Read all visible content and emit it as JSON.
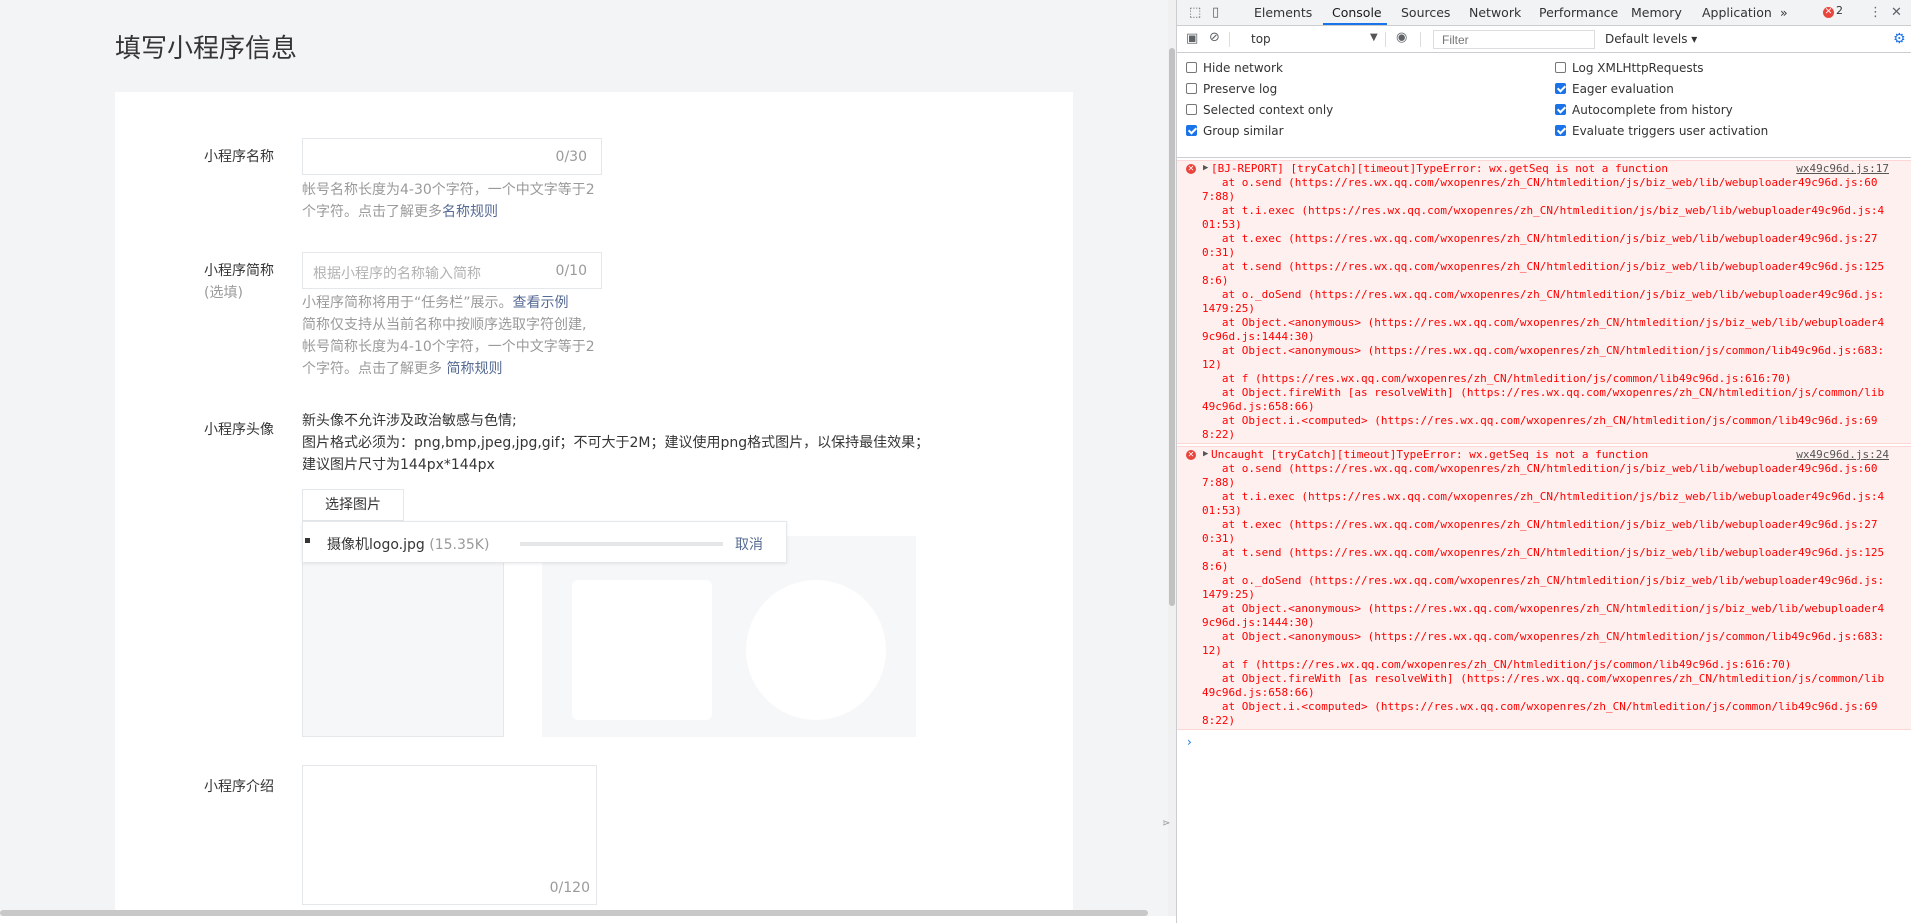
{
  "page": {
    "title": "填写小程序信息",
    "name_label": "小程序名称",
    "name_count": "0/30",
    "name_tip_a": "帐号名称长度为4-30个字符，一个中文字等于2个字符。点击了解更多",
    "name_tip_link": "名称规则",
    "short_label": "小程序简称",
    "short_optional": "(选填)",
    "short_placeholder": "根据小程序的名称输入简称",
    "short_count": "0/10",
    "short_tip_1a": "小程序简称将用于“任务栏”展示。",
    "short_tip_1_link": "查看示例",
    "short_tip_2": "简称仅支持从当前名称中按顺序选取字符创建,",
    "short_tip_3a": "帐号简称长度为4-10个字符，一个中文字等于2个字符。点击了解更多 ",
    "short_tip_3_link": "简称规则",
    "avatar_label": "小程序头像",
    "avatar_line1": "新头像不允许涉及政治敏感与色情;",
    "avatar_line2": "图片格式必须为：png,bmp,jpeg,jpg,gif；不可大于2M；建议使用png格式图片，以保持最佳效果；",
    "avatar_line3": "建议图片尺寸为144px*144px",
    "select_button": "选择图片",
    "upload_filename": "摄像机logo.jpg",
    "upload_size": "(15.35K)",
    "upload_progress": 0.0,
    "upload_cancel": "取消",
    "intro_label": "小程序介绍",
    "intro_count": "0/120"
  },
  "devtools": {
    "tabs": [
      "Elements",
      "Console",
      "Sources",
      "Network",
      "Performance",
      "Memory",
      "Application"
    ],
    "active_tab": "Console",
    "more_tabs": "»",
    "error_count": "2",
    "context": "top",
    "filter_placeholder": "Filter",
    "levels": "Default levels ▾",
    "options_left": [
      {
        "label": "Hide network",
        "checked": false
      },
      {
        "label": "Preserve log",
        "checked": false
      },
      {
        "label": "Selected context only",
        "checked": false
      },
      {
        "label": "Group similar",
        "checked": true
      }
    ],
    "options_right": [
      {
        "label": "Log XMLHttpRequests",
        "checked": false
      },
      {
        "label": "Eager evaluation",
        "checked": true
      },
      {
        "label": "Autocomplete from history",
        "checked": true
      },
      {
        "label": "Evaluate triggers user activation",
        "checked": true
      }
    ],
    "messages": [
      {
        "head": "[BJ-REPORT] [tryCatch][timeout]TypeError: wx.getSeq is not a function",
        "source": "wx49c96d.js:17",
        "stack": "   at o.send (https://res.wx.qq.com/wxopenres/zh_CN/htmledition/js/biz_web/lib/webuploader49c96d.js:607:88)\n   at t.i.exec (https://res.wx.qq.com/wxopenres/zh_CN/htmledition/js/biz_web/lib/webuploader49c96d.js:401:53)\n   at t.exec (https://res.wx.qq.com/wxopenres/zh_CN/htmledition/js/biz_web/lib/webuploader49c96d.js:270:31)\n   at t.send (https://res.wx.qq.com/wxopenres/zh_CN/htmledition/js/biz_web/lib/webuploader49c96d.js:1258:6)\n   at o._doSend (https://res.wx.qq.com/wxopenres/zh_CN/htmledition/js/biz_web/lib/webuploader49c96d.js:1479:25)\n   at Object.<anonymous> (https://res.wx.qq.com/wxopenres/zh_CN/htmledition/js/biz_web/lib/webuploader49c96d.js:1444:30)\n   at Object.<anonymous> (https://res.wx.qq.com/wxopenres/zh_CN/htmledition/js/common/lib49c96d.js:683:12)\n   at f (https://res.wx.qq.com/wxopenres/zh_CN/htmledition/js/common/lib49c96d.js:616:70)\n   at Object.fireWith [as resolveWith] (https://res.wx.qq.com/wxopenres/zh_CN/htmledition/js/common/lib49c96d.js:658:66)\n   at Object.i.<computed> (https://res.wx.qq.com/wxopenres/zh_CN/htmledition/js/common/lib49c96d.js:698:22)"
      },
      {
        "head": "Uncaught [tryCatch][timeout]TypeError: wx.getSeq is not a function",
        "source": "wx49c96d.js:24",
        "stack": "   at o.send (https://res.wx.qq.com/wxopenres/zh_CN/htmledition/js/biz_web/lib/webuploader49c96d.js:607:88)\n   at t.i.exec (https://res.wx.qq.com/wxopenres/zh_CN/htmledition/js/biz_web/lib/webuploader49c96d.js:401:53)\n   at t.exec (https://res.wx.qq.com/wxopenres/zh_CN/htmledition/js/biz_web/lib/webuploader49c96d.js:270:31)\n   at t.send (https://res.wx.qq.com/wxopenres/zh_CN/htmledition/js/biz_web/lib/webuploader49c96d.js:1258:6)\n   at o._doSend (https://res.wx.qq.com/wxopenres/zh_CN/htmledition/js/biz_web/lib/webuploader49c96d.js:1479:25)\n   at Object.<anonymous> (https://res.wx.qq.com/wxopenres/zh_CN/htmledition/js/biz_web/lib/webuploader49c96d.js:1444:30)\n   at Object.<anonymous> (https://res.wx.qq.com/wxopenres/zh_CN/htmledition/js/common/lib49c96d.js:683:12)\n   at f (https://res.wx.qq.com/wxopenres/zh_CN/htmledition/js/common/lib49c96d.js:616:70)\n   at Object.fireWith [as resolveWith] (https://res.wx.qq.com/wxopenres/zh_CN/htmledition/js/common/lib49c96d.js:658:66)\n   at Object.i.<computed> (https://res.wx.qq.com/wxopenres/zh_CN/htmledition/js/common/lib49c96d.js:698:22)"
      }
    ],
    "prompt": "›"
  },
  "colors": {
    "link": "#576b95",
    "error_text": "#ff0000",
    "error_bg": "#fff0f0",
    "devtools_accent": "#1a73e8"
  }
}
